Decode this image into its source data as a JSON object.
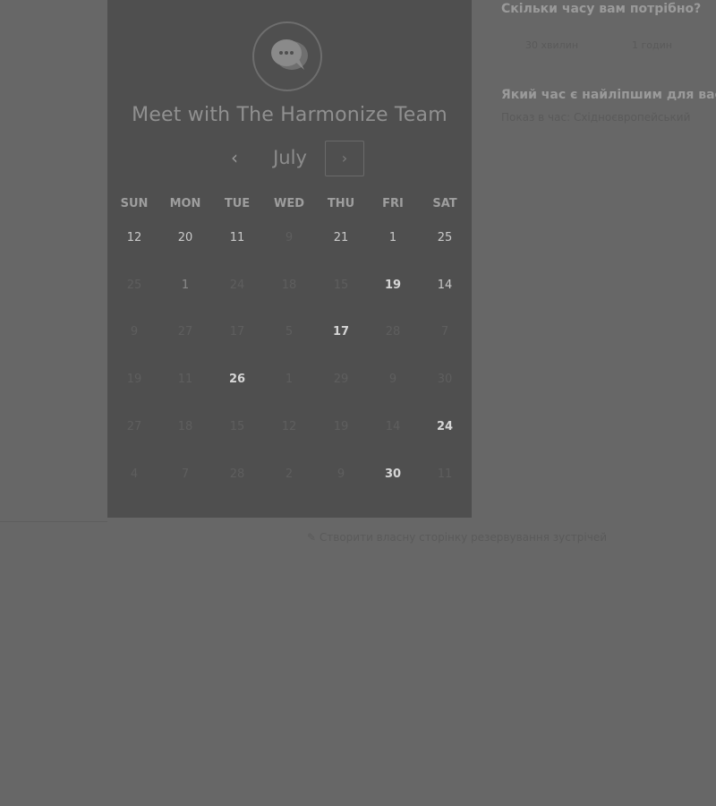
{
  "calendar": {
    "title": "Meet with The Harmonize Team",
    "month": "July",
    "prev_label": "‹",
    "next_label": "›",
    "weekdays": [
      "SUN",
      "MON",
      "TUE",
      "WED",
      "THU",
      "FRI",
      "SAT"
    ],
    "weeks": [
      [
        {
          "d": "12",
          "s": "normal"
        },
        {
          "d": "20",
          "s": "normal"
        },
        {
          "d": "11",
          "s": "normal"
        },
        {
          "d": "9",
          "s": "muted"
        },
        {
          "d": "21",
          "s": "normal"
        },
        {
          "d": "1",
          "s": "normal"
        },
        {
          "d": "25",
          "s": "normal"
        }
      ],
      [
        {
          "d": "25",
          "s": "muted"
        },
        {
          "d": "1",
          "s": "sel"
        },
        {
          "d": "24",
          "s": "muted"
        },
        {
          "d": "18",
          "s": "muted"
        },
        {
          "d": "15",
          "s": "muted"
        },
        {
          "d": "19",
          "s": "avail"
        },
        {
          "d": "14",
          "s": "normal"
        }
      ],
      [
        {
          "d": "9",
          "s": "muted"
        },
        {
          "d": "27",
          "s": "muted"
        },
        {
          "d": "17",
          "s": "muted"
        },
        {
          "d": "5",
          "s": "muted"
        },
        {
          "d": "17",
          "s": "avail"
        },
        {
          "d": "28",
          "s": "muted"
        },
        {
          "d": "7",
          "s": "muted"
        }
      ],
      [
        {
          "d": "19",
          "s": "muted"
        },
        {
          "d": "11",
          "s": "muted"
        },
        {
          "d": "26",
          "s": "avail"
        },
        {
          "d": "1",
          "s": "muted"
        },
        {
          "d": "29",
          "s": "muted"
        },
        {
          "d": "9",
          "s": "muted"
        },
        {
          "d": "30",
          "s": "muted"
        }
      ],
      [
        {
          "d": "27",
          "s": "muted"
        },
        {
          "d": "18",
          "s": "muted"
        },
        {
          "d": "15",
          "s": "muted"
        },
        {
          "d": "12",
          "s": "muted"
        },
        {
          "d": "19",
          "s": "muted"
        },
        {
          "d": "14",
          "s": "muted"
        },
        {
          "d": "24",
          "s": "avail"
        }
      ],
      [
        {
          "d": "4",
          "s": "muted"
        },
        {
          "d": "7",
          "s": "muted"
        },
        {
          "d": "28",
          "s": "muted"
        },
        {
          "d": "2",
          "s": "muted"
        },
        {
          "d": "9",
          "s": "muted"
        },
        {
          "d": "30",
          "s": "avail"
        },
        {
          "d": "11",
          "s": "muted"
        }
      ]
    ]
  },
  "booking": {
    "duration_question": "Скільки часу вам потрібно?",
    "durations": [
      "30 хвилин",
      "1 годин"
    ],
    "time_question": "Який час є найліпшим для вас?",
    "timezone_label": "Показ в час: Східноєвропейський"
  },
  "footer": {
    "create_page_label": "Створити власну сторінку резервування зустрічей"
  }
}
